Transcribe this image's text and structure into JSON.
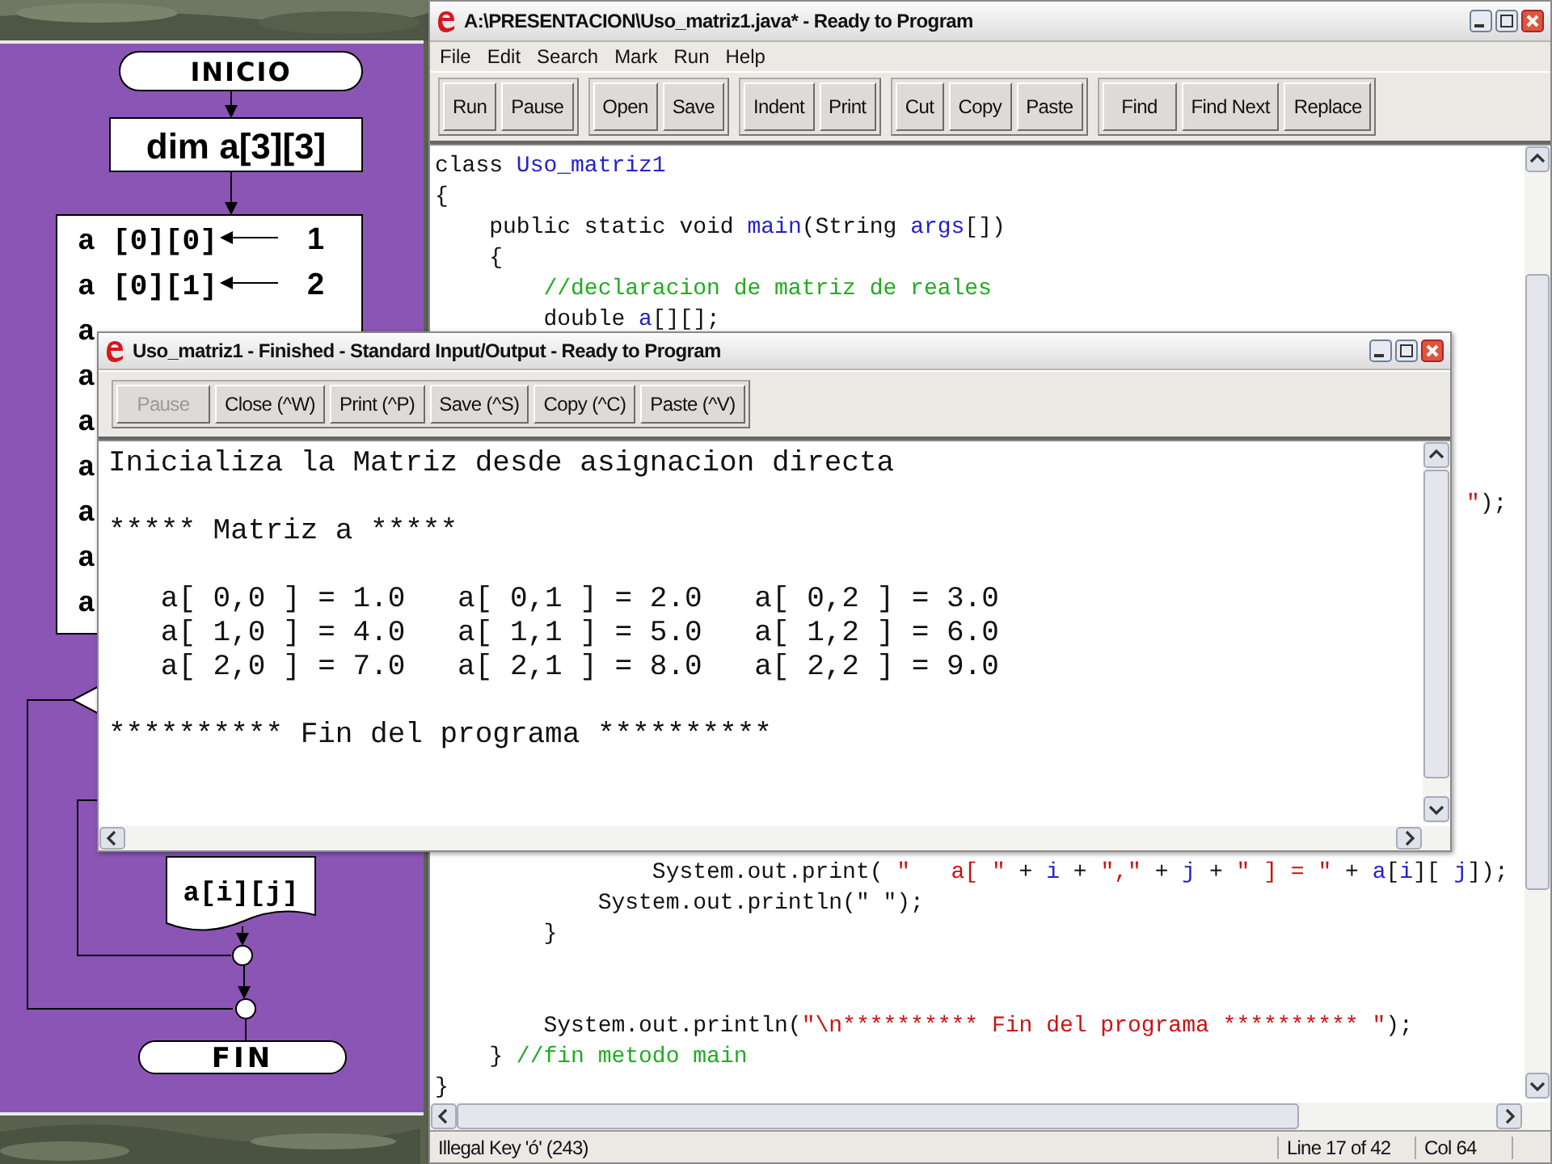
{
  "flowchart": {
    "start": "INICIO",
    "declaration": "dim a[3][3]",
    "assignments": [
      {
        "target": "a [0][0]",
        "value": "1"
      },
      {
        "target": "a [0][1]",
        "value": "2"
      },
      {
        "target": "a"
      },
      {
        "target": "a"
      },
      {
        "target": "a"
      },
      {
        "target": "a"
      },
      {
        "target": "a"
      },
      {
        "target": "a"
      },
      {
        "target": "a"
      }
    ],
    "output": "a[i][j]",
    "end": "FIN"
  },
  "editor_window": {
    "title": "A:\\PRESENTACION\\Uso_matriz1.java* - Ready to Program",
    "menu": [
      "File",
      "Edit",
      "Search",
      "Mark",
      "Run",
      "Help"
    ],
    "toolbar_groups": [
      [
        "Run",
        "Pause"
      ],
      [
        "Open",
        "Save"
      ],
      [
        "Indent",
        "Print"
      ],
      [
        "Cut",
        "Copy",
        "Paste"
      ],
      [
        "Find",
        "Find Next",
        "Replace"
      ]
    ],
    "code_lines": [
      {
        "kind": "code",
        "tokens": [
          {
            "kind": "text",
            "text": "class "
          },
          {
            "kind": "name",
            "text": "Uso_matriz1"
          }
        ]
      },
      {
        "kind": "code",
        "tokens": [
          {
            "kind": "text",
            "text": "{"
          }
        ]
      },
      {
        "kind": "code",
        "tokens": [
          {
            "kind": "text",
            "text": "    public static void "
          },
          {
            "kind": "name",
            "text": "main"
          },
          {
            "kind": "text",
            "text": "(String "
          },
          {
            "kind": "name",
            "text": "args"
          },
          {
            "kind": "text",
            "text": "[])"
          }
        ]
      },
      {
        "kind": "code",
        "tokens": [
          {
            "kind": "text",
            "text": "    {"
          }
        ]
      },
      {
        "kind": "code",
        "tokens": [
          {
            "kind": "comment",
            "text": "        //declaracion de matriz de reales"
          }
        ]
      },
      {
        "kind": "code",
        "tokens": [
          {
            "kind": "text",
            "text": "        double "
          },
          {
            "kind": "name",
            "text": "a"
          },
          {
            "kind": "text",
            "text": "[][];"
          }
        ]
      },
      {
        "kind": "blank"
      },
      {
        "kind": "blank"
      },
      {
        "kind": "blank"
      },
      {
        "kind": "blank"
      },
      {
        "kind": "blank"
      },
      {
        "kind": "fragment",
        "tokens": [
          {
            "kind": "string",
            "text": "\""
          },
          {
            "kind": "text",
            "text": ");"
          }
        ]
      },
      {
        "kind": "blank"
      },
      {
        "kind": "blank"
      },
      {
        "kind": "blank"
      },
      {
        "kind": "blank"
      },
      {
        "kind": "blank"
      },
      {
        "kind": "blank"
      },
      {
        "kind": "blank"
      },
      {
        "kind": "blank"
      },
      {
        "kind": "blank"
      },
      {
        "kind": "blank"
      },
      {
        "kind": "blank"
      },
      {
        "kind": "code",
        "tokens": [
          {
            "kind": "text",
            "text": "                System.out.print( "
          },
          {
            "kind": "string",
            "text": "\"   a[ \""
          },
          {
            "kind": "text",
            "text": " + "
          },
          {
            "kind": "name",
            "text": "i"
          },
          {
            "kind": "text",
            "text": " + "
          },
          {
            "kind": "string",
            "text": "\",\""
          },
          {
            "kind": "text",
            "text": " + "
          },
          {
            "kind": "name",
            "text": "j"
          },
          {
            "kind": "text",
            "text": " + "
          },
          {
            "kind": "string",
            "text": "\" ] = \""
          },
          {
            "kind": "text",
            "text": " + "
          },
          {
            "kind": "name",
            "text": "a"
          },
          {
            "kind": "text",
            "text": "["
          },
          {
            "kind": "name",
            "text": "i"
          },
          {
            "kind": "text",
            "text": "][ "
          },
          {
            "kind": "name",
            "text": "j"
          },
          {
            "kind": "text",
            "text": "]);"
          }
        ]
      },
      {
        "kind": "code",
        "tokens": [
          {
            "kind": "text",
            "text": "            System.out.println(\" \");"
          }
        ]
      },
      {
        "kind": "code",
        "tokens": [
          {
            "kind": "text",
            "text": "        }"
          }
        ]
      },
      {
        "kind": "blank"
      },
      {
        "kind": "blank"
      },
      {
        "kind": "code",
        "tokens": [
          {
            "kind": "text",
            "text": "        System.out.println("
          },
          {
            "kind": "string",
            "text": "\"\\n********** Fin del programa ********** \""
          },
          {
            "kind": "text",
            "text": ");"
          }
        ]
      },
      {
        "kind": "code",
        "tokens": [
          {
            "kind": "text",
            "text": "    } "
          },
          {
            "kind": "comment",
            "text": "//fin metodo main"
          }
        ]
      },
      {
        "kind": "code",
        "tokens": [
          {
            "kind": "text",
            "text": "}"
          }
        ]
      }
    ],
    "status": {
      "message": "Illegal Key 'ó' (243)",
      "line": "Line 17 of 42",
      "column": "Col 64"
    }
  },
  "output_window": {
    "title": "Uso_matriz1 - Finished  - Standard Input/Output - Ready to Program",
    "toolbar": [
      {
        "label": "Pause",
        "disabled": true
      },
      {
        "label": "Close (^W)",
        "disabled": false
      },
      {
        "label": "Print (^P)",
        "disabled": false
      },
      {
        "label": "Save (^S)",
        "disabled": false
      },
      {
        "label": "Copy (^C)",
        "disabled": false
      },
      {
        "label": "Paste (^V)",
        "disabled": false
      }
    ],
    "blocks": [
      [
        "Inicializa la Matriz desde asignacion directa"
      ],
      [
        "***** Matriz a *****"
      ],
      [
        "   a[ 0,0 ] = 1.0   a[ 0,1 ] = 2.0   a[ 0,2 ] = 3.0",
        "   a[ 1,0 ] = 4.0   a[ 1,1 ] = 5.0   a[ 1,2 ] = 6.0",
        "   a[ 2,0 ] = 7.0   a[ 2,1 ] = 8.0   a[ 2,2 ] = 9.0"
      ],
      [
        "********** Fin del programa **********"
      ]
    ]
  }
}
